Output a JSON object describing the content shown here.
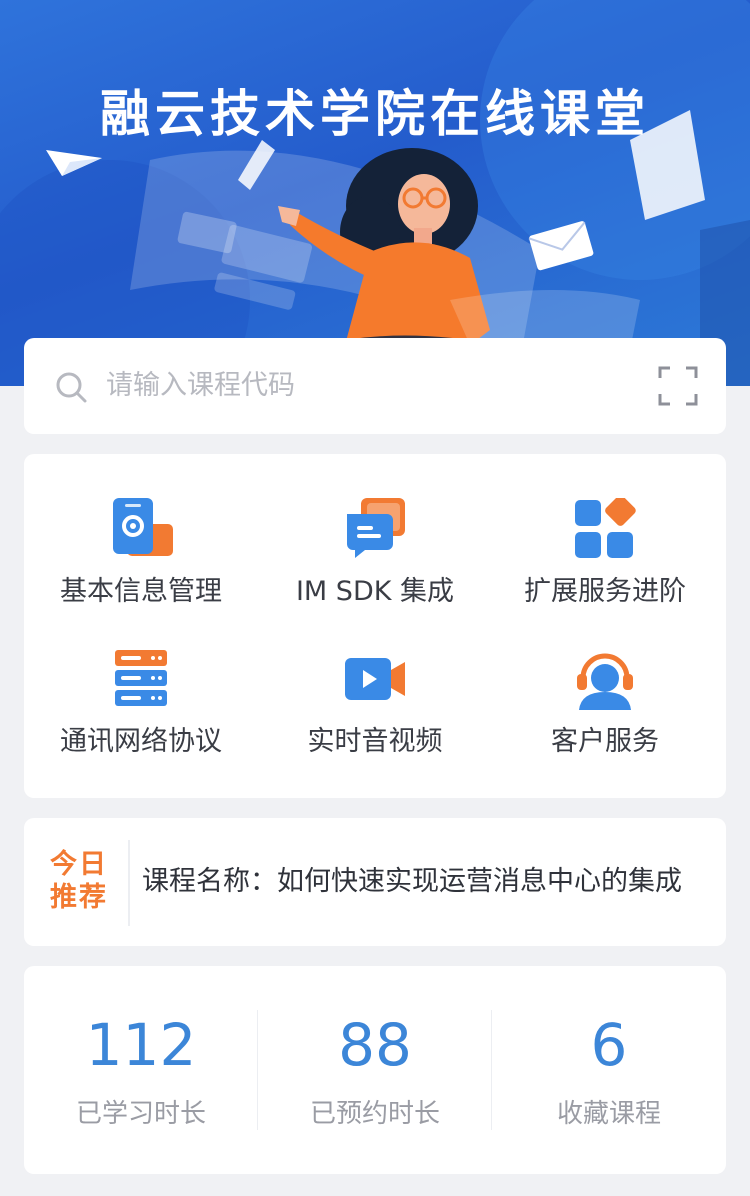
{
  "banner": {
    "title": "融云技术学院在线课堂"
  },
  "search": {
    "placeholder": "请输入课程代码"
  },
  "menu": {
    "items": [
      {
        "label": "基本信息管理",
        "icon": "settings-phone-icon"
      },
      {
        "label": "IM SDK 集成",
        "icon": "chat-bubbles-icon"
      },
      {
        "label": "扩展服务进阶",
        "icon": "grid-apps-icon"
      },
      {
        "label": "通讯网络协议",
        "icon": "server-stack-icon"
      },
      {
        "label": "实时音视频",
        "icon": "video-camera-icon"
      },
      {
        "label": "客户服务",
        "icon": "headset-agent-icon"
      }
    ]
  },
  "recommend": {
    "badge_line1": "今日",
    "badge_line2": "推荐",
    "text": "课程名称：如何快速实现运营消息中心的集成"
  },
  "stats": [
    {
      "value": "112",
      "label": "已学习时长"
    },
    {
      "value": "88",
      "label": "已预约时长"
    },
    {
      "value": "6",
      "label": "收藏课程"
    }
  ],
  "colors": {
    "accent_blue": "#3c86d8",
    "accent_orange": "#f27a32",
    "banner_blue": "#245ccc",
    "background": "#f0f1f4"
  }
}
